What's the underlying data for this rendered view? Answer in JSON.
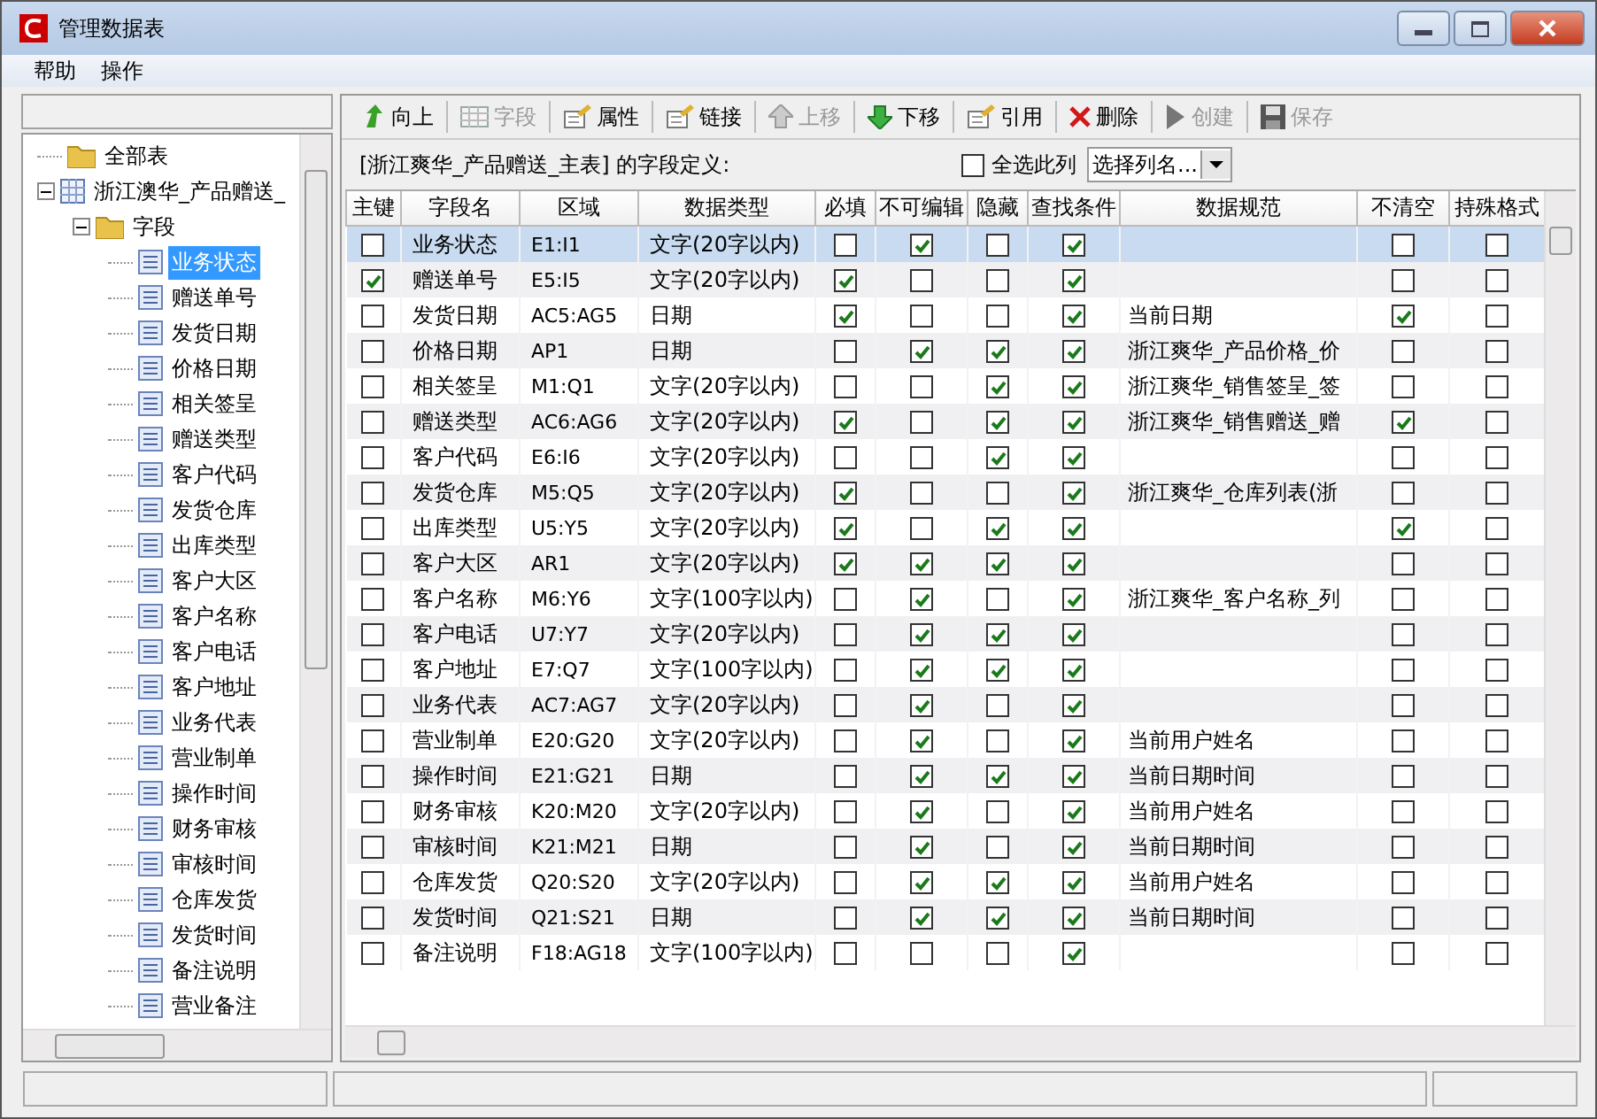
{
  "window": {
    "title": "管理数据表"
  },
  "menu": [
    "帮助",
    "操作"
  ],
  "tree": [
    {
      "label": "全部表",
      "kind": "folder",
      "selected": false
    },
    {
      "label": "浙江澳华_产品赠送_",
      "kind": "table",
      "expanded": true,
      "selected": false,
      "children": [
        {
          "label": "字段",
          "kind": "folder",
          "expanded": true,
          "selected": false,
          "children": [
            {
              "label": "业务状态",
              "kind": "field",
              "selected": true
            },
            {
              "label": "赠送单号",
              "kind": "field",
              "selected": false
            },
            {
              "label": "发货日期",
              "kind": "field",
              "selected": false
            },
            {
              "label": "价格日期",
              "kind": "field",
              "selected": false
            },
            {
              "label": "相关签呈",
              "kind": "field",
              "selected": false
            },
            {
              "label": "赠送类型",
              "kind": "field",
              "selected": false
            },
            {
              "label": "客户代码",
              "kind": "field",
              "selected": false
            },
            {
              "label": "发货仓库",
              "kind": "field",
              "selected": false
            },
            {
              "label": "出库类型",
              "kind": "field",
              "selected": false
            },
            {
              "label": "客户大区",
              "kind": "field",
              "selected": false
            },
            {
              "label": "客户名称",
              "kind": "field",
              "selected": false
            },
            {
              "label": "客户电话",
              "kind": "field",
              "selected": false
            },
            {
              "label": "客户地址",
              "kind": "field",
              "selected": false
            },
            {
              "label": "业务代表",
              "kind": "field",
              "selected": false
            },
            {
              "label": "营业制单",
              "kind": "field",
              "selected": false
            },
            {
              "label": "操作时间",
              "kind": "field",
              "selected": false
            },
            {
              "label": "财务审核",
              "kind": "field",
              "selected": false
            },
            {
              "label": "审核时间",
              "kind": "field",
              "selected": false
            },
            {
              "label": "仓库发货",
              "kind": "field",
              "selected": false
            },
            {
              "label": "发货时间",
              "kind": "field",
              "selected": false
            },
            {
              "label": "备注说明",
              "kind": "field",
              "selected": false
            },
            {
              "label": "营业备注",
              "kind": "field",
              "selected": false
            }
          ]
        }
      ]
    }
  ],
  "toolbar": [
    {
      "label": "向上",
      "disabled": false
    },
    {
      "label": "字段",
      "disabled": true
    },
    {
      "label": "属性",
      "disabled": false
    },
    {
      "label": "链接",
      "disabled": false
    },
    {
      "label": "上移",
      "disabled": true
    },
    {
      "label": "下移",
      "disabled": false
    },
    {
      "label": "引用",
      "disabled": false
    },
    {
      "label": "删除",
      "disabled": false
    },
    {
      "label": "创建",
      "disabled": true
    },
    {
      "label": "保存",
      "disabled": true
    }
  ],
  "heading": "[浙江爽华_产品赠送_主表] 的字段定义:",
  "select_all": {
    "label": "全选此列",
    "checked": false
  },
  "column_select": {
    "value": "选择列名..."
  },
  "table": {
    "columns": [
      "主键",
      "字段名",
      "区域",
      "数据类型",
      "必填",
      "不可编辑",
      "隐藏",
      "查找条件",
      "数据规范",
      "不清空",
      "持殊格式"
    ],
    "rows": [
      {
        "selected": true,
        "key": false,
        "name": "业务状态",
        "range": "E1:I1",
        "type": "文字(20字以内)",
        "required": false,
        "readonly": true,
        "hidden": false,
        "search": true,
        "spec": "",
        "keep": false,
        "special": false
      },
      {
        "selected": false,
        "key": true,
        "name": "赠送单号",
        "range": "E5:I5",
        "type": "文字(20字以内)",
        "required": true,
        "readonly": false,
        "hidden": false,
        "search": true,
        "spec": "",
        "keep": false,
        "special": false
      },
      {
        "selected": false,
        "key": false,
        "name": "发货日期",
        "range": "AC5:AG5",
        "type": "日期",
        "required": true,
        "readonly": false,
        "hidden": false,
        "search": true,
        "spec": "当前日期",
        "keep": true,
        "special": false
      },
      {
        "selected": false,
        "key": false,
        "name": "价格日期",
        "range": "AP1",
        "type": "日期",
        "required": false,
        "readonly": true,
        "hidden": true,
        "search": true,
        "spec": "浙江爽华_产品价格_价",
        "keep": false,
        "special": false
      },
      {
        "selected": false,
        "key": false,
        "name": "相关签呈",
        "range": "M1:Q1",
        "type": "文字(20字以内)",
        "required": false,
        "readonly": false,
        "hidden": true,
        "search": true,
        "spec": "浙江爽华_销售签呈_签",
        "keep": false,
        "special": false
      },
      {
        "selected": false,
        "key": false,
        "name": "赠送类型",
        "range": "AC6:AG6",
        "type": "文字(20字以内)",
        "required": true,
        "readonly": false,
        "hidden": true,
        "search": true,
        "spec": "浙江爽华_销售赠送_赠",
        "keep": true,
        "special": false
      },
      {
        "selected": false,
        "key": false,
        "name": "客户代码",
        "range": "E6:I6",
        "type": "文字(20字以内)",
        "required": false,
        "readonly": false,
        "hidden": true,
        "search": true,
        "spec": "",
        "keep": false,
        "special": false
      },
      {
        "selected": false,
        "key": false,
        "name": "发货仓库",
        "range": "M5:Q5",
        "type": "文字(20字以内)",
        "required": true,
        "readonly": false,
        "hidden": false,
        "search": true,
        "spec": "浙江爽华_仓库列表(浙",
        "keep": false,
        "special": false
      },
      {
        "selected": false,
        "key": false,
        "name": "出库类型",
        "range": "U5:Y5",
        "type": "文字(20字以内)",
        "required": true,
        "readonly": false,
        "hidden": true,
        "search": true,
        "spec": "",
        "keep": true,
        "special": false
      },
      {
        "selected": false,
        "key": false,
        "name": "客户大区",
        "range": "AR1",
        "type": "文字(20字以内)",
        "required": true,
        "readonly": true,
        "hidden": true,
        "search": true,
        "spec": "",
        "keep": false,
        "special": false
      },
      {
        "selected": false,
        "key": false,
        "name": "客户名称",
        "range": "M6:Y6",
        "type": "文字(100字以内)",
        "required": false,
        "readonly": true,
        "hidden": false,
        "search": true,
        "spec": "浙江爽华_客户名称_列",
        "keep": false,
        "special": false
      },
      {
        "selected": false,
        "key": false,
        "name": "客户电话",
        "range": "U7:Y7",
        "type": "文字(20字以内)",
        "required": false,
        "readonly": true,
        "hidden": true,
        "search": true,
        "spec": "",
        "keep": false,
        "special": false
      },
      {
        "selected": false,
        "key": false,
        "name": "客户地址",
        "range": "E7:Q7",
        "type": "文字(100字以内)",
        "required": false,
        "readonly": true,
        "hidden": true,
        "search": true,
        "spec": "",
        "keep": false,
        "special": false
      },
      {
        "selected": false,
        "key": false,
        "name": "业务代表",
        "range": "AC7:AG7",
        "type": "文字(20字以内)",
        "required": false,
        "readonly": true,
        "hidden": false,
        "search": true,
        "spec": "",
        "keep": false,
        "special": false
      },
      {
        "selected": false,
        "key": false,
        "name": "营业制单",
        "range": "E20:G20",
        "type": "文字(20字以内)",
        "required": false,
        "readonly": true,
        "hidden": false,
        "search": true,
        "spec": "当前用户姓名",
        "keep": false,
        "special": false
      },
      {
        "selected": false,
        "key": false,
        "name": "操作时间",
        "range": "E21:G21",
        "type": "日期",
        "required": false,
        "readonly": true,
        "hidden": true,
        "search": true,
        "spec": "当前日期时间",
        "keep": false,
        "special": false
      },
      {
        "selected": false,
        "key": false,
        "name": "财务审核",
        "range": "K20:M20",
        "type": "文字(20字以内)",
        "required": false,
        "readonly": true,
        "hidden": false,
        "search": true,
        "spec": "当前用户姓名",
        "keep": false,
        "special": false
      },
      {
        "selected": false,
        "key": false,
        "name": "审核时间",
        "range": "K21:M21",
        "type": "日期",
        "required": false,
        "readonly": true,
        "hidden": false,
        "search": true,
        "spec": "当前日期时间",
        "keep": false,
        "special": false
      },
      {
        "selected": false,
        "key": false,
        "name": "仓库发货",
        "range": "Q20:S20",
        "type": "文字(20字以内)",
        "required": false,
        "readonly": true,
        "hidden": true,
        "search": true,
        "spec": "当前用户姓名",
        "keep": false,
        "special": false
      },
      {
        "selected": false,
        "key": false,
        "name": "发货时间",
        "range": "Q21:S21",
        "type": "日期",
        "required": false,
        "readonly": true,
        "hidden": true,
        "search": true,
        "spec": "当前日期时间",
        "keep": false,
        "special": false
      },
      {
        "selected": false,
        "key": false,
        "name": "备注说明",
        "range": "F18:AG18",
        "type": "文字(100字以内)",
        "required": false,
        "readonly": false,
        "hidden": false,
        "search": true,
        "spec": "",
        "keep": false,
        "special": false
      }
    ]
  }
}
